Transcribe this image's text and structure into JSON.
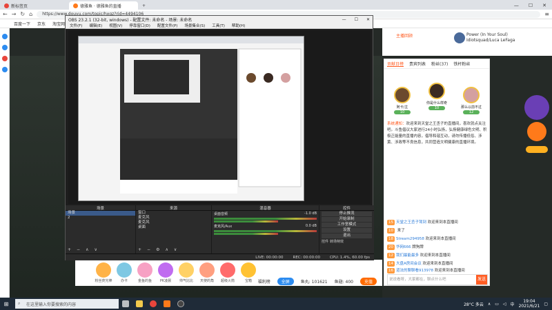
{
  "browser": {
    "tabs": [
      {
        "label": "新标签页",
        "icon": "chrome-icon"
      },
      {
        "label": "德雅鱼 · 德雅鱼的直播",
        "icon": "douyu-icon"
      }
    ],
    "url": "https://www.douyu.com/topic/hxgz?rid=4494106",
    "bookmarks": [
      "百度一下",
      "京东",
      "淘宝网"
    ]
  },
  "page": {
    "header": {
      "user_name": "Power (In Your Soul)",
      "user_sub": "Idiotsquad/Luca LeFaga",
      "follow_label": "主播回顾"
    },
    "chat": {
      "tabs": [
        "贡献日榜",
        "贵宾列表",
        "粉丝(37)",
        "铁杆粉丝"
      ],
      "ranks": [
        {
          "name": "阿卡/主",
          "level": "10"
        },
        {
          "name": "你是什么样奇",
          "level": "10"
        },
        {
          "name": "那么以前不过",
          "level": "12"
        }
      ],
      "notice_prefix": "系统通知：",
      "notice_body": "欢迎来到天堂之王丞子的直播间，喜欢就点关注吧。斗鱼倡议大家进行24小时弘扬，弘扬健康绿色文明、积极正能量的直播内容，倡导和谐互动，请勿传播低俗、涉黄、涉政等不良信息，共同营造文明健康的直播环境。",
      "messages": [
        {
          "level": "15",
          "user": "天堂之王丞子驾到",
          "text": "欢迎来到本直播间"
        },
        {
          "level": "10",
          "user": "",
          "text": "来了"
        },
        {
          "level": "18",
          "user": "Stream294958",
          "text": "欢迎来到本直播间"
        },
        {
          "level": "20",
          "user": "华网666",
          "text": "牌狗牌"
        },
        {
          "level": "12",
          "user": "我们最能最多",
          "text": "欢迎来到本直播间"
        },
        {
          "level": "14",
          "user": "大盘A房间会议",
          "text": "欢迎来到本直播间"
        },
        {
          "level": "16",
          "user": "道法的聊聊看913978",
          "text": "欢迎来到本直播间"
        }
      ],
      "input_placeholder": "说说看呀，大家都在，聊点什么吧",
      "send_label": "发送"
    },
    "gifts": [
      "粉丝荧光棒",
      "办卡",
      "金鱼的鱼",
      "PK凌晨",
      "帅气比比",
      "天使的角",
      "超级火箭",
      "宝箱"
    ],
    "infobar": {
      "left_label": "福利榜",
      "fullscreen_label": "全屏",
      "fish_balls": "鱼丸: 101621",
      "fish_fins": "鱼翅: 400",
      "recharge_label": "充值"
    }
  },
  "obs": {
    "title": "OBS 23.2.1 (32-bit, windows) - 配置文件: 未命名 - 场景: 未命名",
    "menu": [
      "文件(F)",
      "编辑(E)",
      "视图(V)",
      "停靠窗口(D)",
      "配置文件(P)",
      "场景集合(S)",
      "工具(T)",
      "帮助(H)"
    ],
    "docks": {
      "scenes_title": "场景",
      "scenes": [
        "场景",
        "2"
      ],
      "sources_title": "来源",
      "sources": [
        "窗口",
        "麦克风",
        "麦克风",
        "桌面"
      ],
      "mixer_title": "混音器",
      "mixer": [
        {
          "name": "桌面音频",
          "db": "-1.0 dB"
        },
        {
          "name": "麦克风/Aux",
          "db": "0.0 dB"
        }
      ],
      "controls_title": "控件",
      "controls": [
        "停止推流",
        "开始录制",
        "工作室模式",
        "设置",
        "退出"
      ],
      "transitions": [
        "控件",
        "转场特效"
      ]
    },
    "status": {
      "live": "LIVE: 00:00:00",
      "rec": "REC: 00:00:00",
      "cpu": "CPU: 1.4%, 60.00 fps"
    }
  },
  "taskbar": {
    "search_placeholder": "在这里输入你要搜索的内容",
    "temp": "28°C 多云",
    "ime": "中",
    "time": "19:04",
    "date": "2021/6/21"
  }
}
